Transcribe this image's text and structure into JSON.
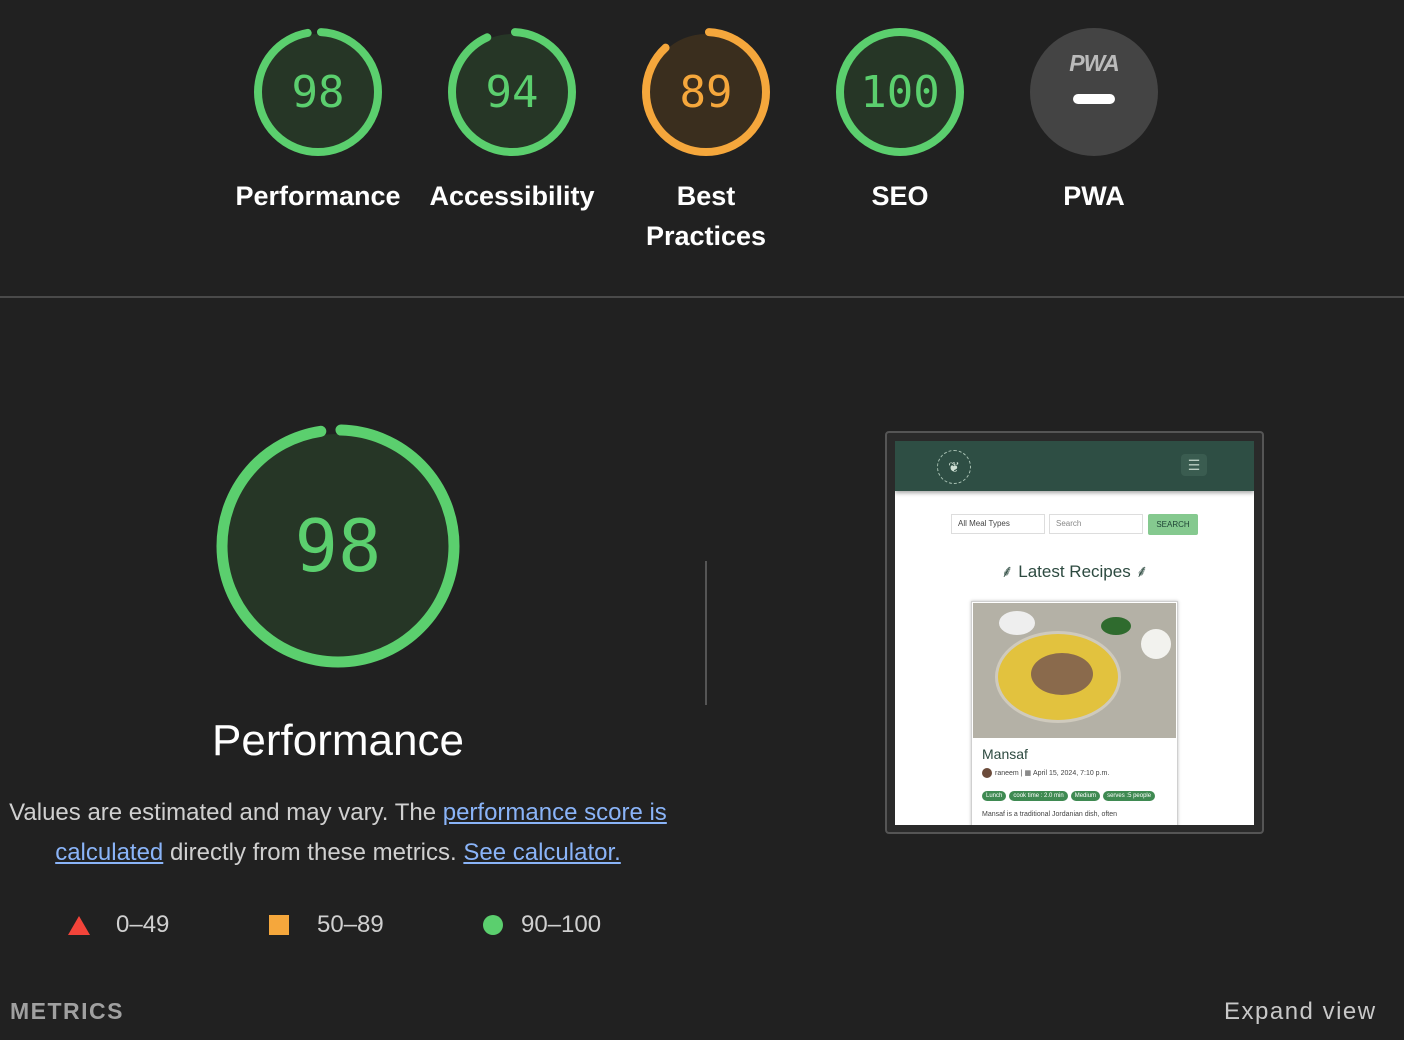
{
  "colors": {
    "pass": "#5bcf6e",
    "average": "#f5a73c",
    "fail": "#f3443a",
    "pass_bg": "#263626",
    "average_bg": "#3a2e1e"
  },
  "categories": [
    {
      "label": "Performance",
      "score": "98",
      "value": 98,
      "status": "pass"
    },
    {
      "label": "Accessibility",
      "score": "94",
      "value": 94,
      "status": "pass"
    },
    {
      "label": "Best Practices",
      "score": "89",
      "value": 89,
      "status": "average"
    },
    {
      "label": "SEO",
      "score": "100",
      "value": 100,
      "status": "pass"
    },
    {
      "label": "PWA",
      "logo": "PWA",
      "status": "na"
    }
  ],
  "performance": {
    "score": "98",
    "value": 98,
    "title": "Performance",
    "desc_prefix": "Values are estimated and may vary. The ",
    "link_score": "performance score is calculated",
    "desc_middle": " directly from these metrics. ",
    "link_calc": "See calculator."
  },
  "legend": [
    {
      "range": "0–49",
      "icon": "fail-triangle-icon"
    },
    {
      "range": "50–89",
      "icon": "average-square-icon"
    },
    {
      "range": "90–100",
      "icon": "pass-circle-icon"
    }
  ],
  "screenshot": {
    "select_value": "All Meal Types",
    "search_placeholder": "Search",
    "search_button": "SEARCH",
    "heading": "Latest Recipes",
    "recipe_name": "Mansaf",
    "author": "raneem",
    "date": "April 15, 2024, 7:10 p.m.",
    "tags": [
      "Lunch",
      "cook time : 2.0 min",
      "Medium",
      "serves :5 people"
    ],
    "snippet": "Mansaf is a traditional Jordanian dish, often"
  },
  "footer": {
    "metrics_label": "METRICS",
    "expand_label": "Expand view"
  }
}
